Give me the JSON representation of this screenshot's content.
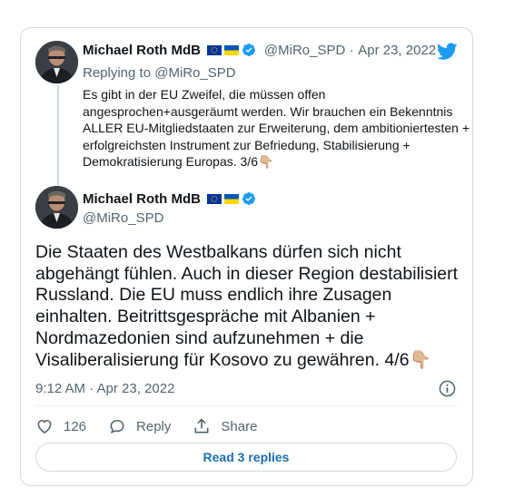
{
  "quoted_tweet": {
    "author_name": "Michael Roth MdB",
    "handle": "@MiRo_SPD",
    "separator": "·",
    "date": "Apr 23, 2022",
    "replying_label": "Replying to",
    "replying_to": "@MiRo_SPD",
    "text": "Es gibt in der EU Zweifel, die müssen offen angesprochen+ausgeräumt werden. Wir brauchen ein Bekenntnis ALLER EU-Mitgliedstaaten zur Erweiterung, dem ambitioniertesten + erfolgreichsten Instrument zur Befriedung, Stabilisierung + Demokratisierung Europas. 3/6👇🏼"
  },
  "main_tweet": {
    "author_name": "Michael Roth MdB",
    "handle": "@MiRo_SPD",
    "text": "Die Staaten des Westbalkans dürfen sich nicht abgehängt fühlen. Auch in dieser Region destabilisiert Russland. Die EU muss endlich ihre Zusagen einhalten. Beitrittsgespräche mit Albanien + Nordmazedonien sind aufzunehmen + die Visaliberalisierung für Kosovo zu gewähren. 4/6👇🏼",
    "timestamp": "9:12 AM · Apr 23, 2022"
  },
  "actions": {
    "like_count": "126",
    "reply_label": "Reply",
    "share_label": "Share"
  },
  "read_replies_label": "Read 3 replies",
  "colors": {
    "twitter_blue": "#1d9bf0",
    "link_blue": "#1d6db5",
    "secondary_text": "#536471",
    "border": "#cfd9de"
  }
}
